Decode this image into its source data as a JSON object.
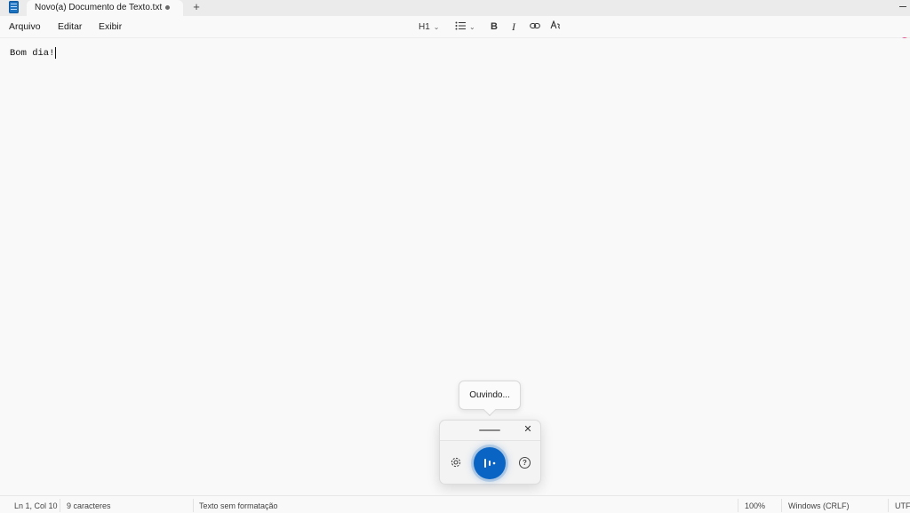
{
  "window": {
    "tab_title": "Novo(a) Documento de Texto.txt",
    "new_tab_symbol": "+"
  },
  "menu": {
    "file": "Arquivo",
    "edit": "Editar",
    "view": "Exibir"
  },
  "toolbar": {
    "heading": "H1",
    "list_icon": "list-icon",
    "bold": "B",
    "italic": "I",
    "link_icon": "link-icon",
    "clear_format_icon": "clear-formatting-icon"
  },
  "document": {
    "content": "Bom dia!"
  },
  "status": {
    "position": "Ln 1, Col 10",
    "char_count": "9 caracteres",
    "format": "Texto sem formatação",
    "zoom": "100%",
    "line_ending": "Windows (CRLF)",
    "encoding": "UTF-"
  },
  "voice": {
    "tooltip": "Ouvindo...",
    "close_symbol": "✕",
    "settings_icon": "gear-icon",
    "mic_icon": "voice-listening-icon",
    "help_symbol": "?",
    "accent": "#0a64c4"
  }
}
